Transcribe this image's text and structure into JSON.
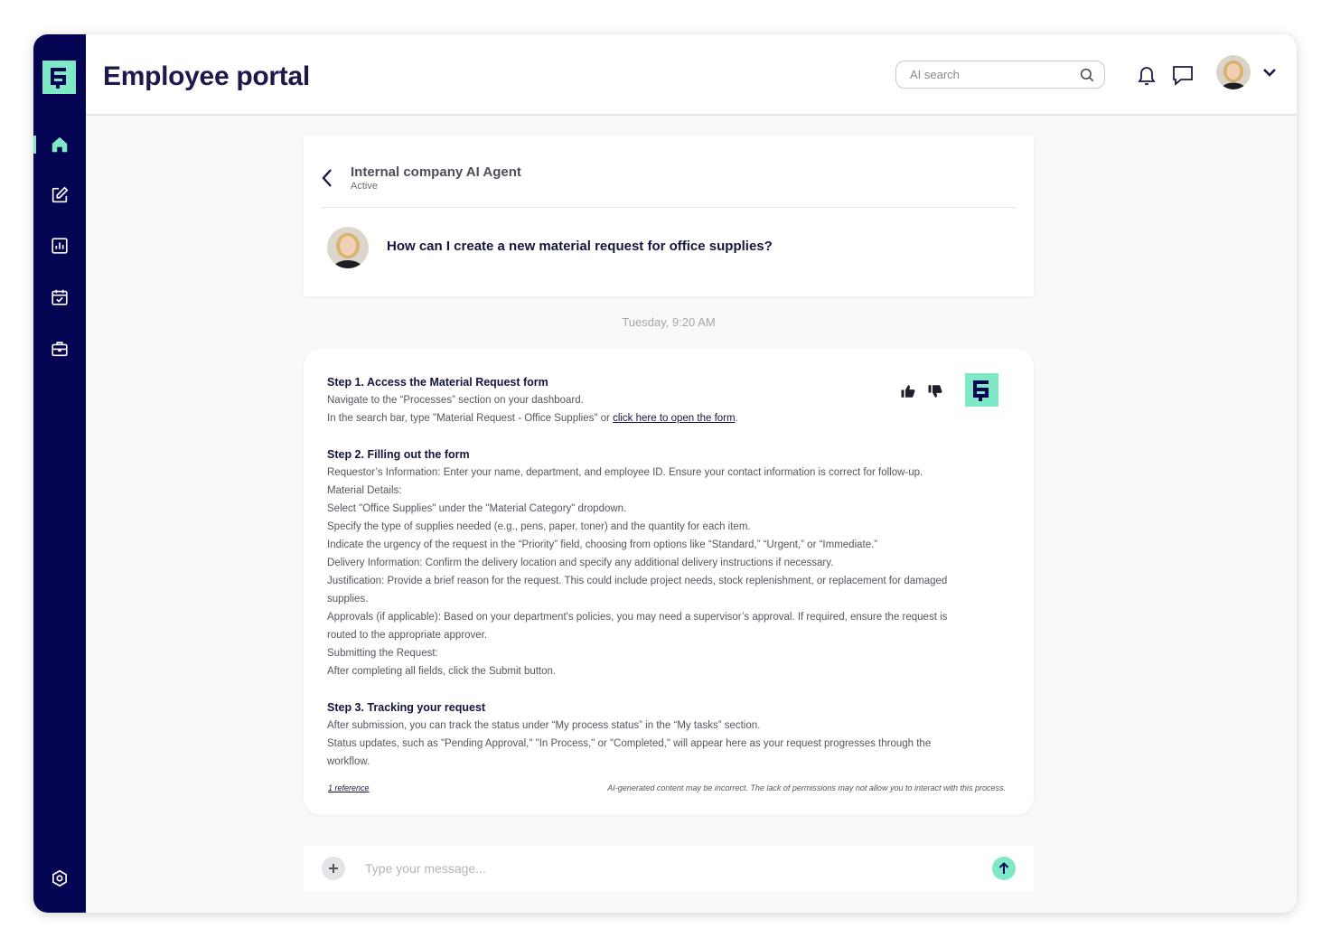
{
  "header": {
    "title": "Employee portal",
    "search_placeholder": "AI search"
  },
  "sidebar": {
    "items": [
      {
        "name": "home-icon",
        "active": true
      },
      {
        "name": "edit-icon",
        "active": false
      },
      {
        "name": "chart-icon",
        "active": false
      },
      {
        "name": "calendar-icon",
        "active": false
      },
      {
        "name": "briefcase-icon",
        "active": false
      }
    ],
    "bottom_item": "settings-icon"
  },
  "chat": {
    "agent_name": "Internal company AI Agent",
    "agent_status": "Active",
    "question": "How can I create a new material request for office supplies?",
    "timestamp": "Tuesday, 9:20 AM",
    "answer": {
      "step1_title": "Step 1. Access the Material Request form",
      "step1_lines": [
        "Navigate to the “Processes” section on your dashboard."
      ],
      "step1_line2_prefix": "In the search bar, type \"Material Request - Office Supplies\" or ",
      "step1_link": "click here to open the form",
      "step1_line2_suffix": ".",
      "step2_title": "Step 2. Filling out the form",
      "step2_lines": [
        "Requestor’s Information: Enter your name, department, and employee ID. Ensure your contact information is correct for follow-up.",
        "Material Details:",
        "Select \"Office Supplies\" under the \"Material Category\" dropdown.",
        "Specify the type of supplies needed (e.g., pens, paper, toner) and the quantity for each item.",
        "Indicate the urgency of the request in the “Priority” field, choosing from options like “Standard,” “Urgent,” or “Immediate.”",
        "Delivery Information: Confirm the delivery location and specify any additional delivery instructions if necessary.",
        "Justification: Provide a brief reason for the request. This could include project needs, stock replenishment, or replacement for damaged supplies.",
        "Approvals (if applicable): Based on your department's policies, you may need a supervisor’s approval. If required, ensure the request is routed to the appropriate approver.",
        "Submitting the Request:",
        "After completing all fields, click the Submit button."
      ],
      "step3_title": "Step 3. Tracking your request",
      "step3_lines": [
        "After submission, you can track the status under “My process status” in the “My tasks” section.",
        "Status updates, such as \"Pending Approval,\" \"In Process,\" or \"Completed,\" will appear here as your request progresses through the workflow."
      ],
      "reference": "1 reference",
      "disclaimer": "AI-generated content may be incorrect. The lack of permissions may not allow you to interact with  this process."
    },
    "composer_placeholder": "Type your message..."
  },
  "colors": {
    "sidebar_bg": "#050452",
    "accent": "#7fe8c7",
    "title": "#1b1a4a"
  }
}
